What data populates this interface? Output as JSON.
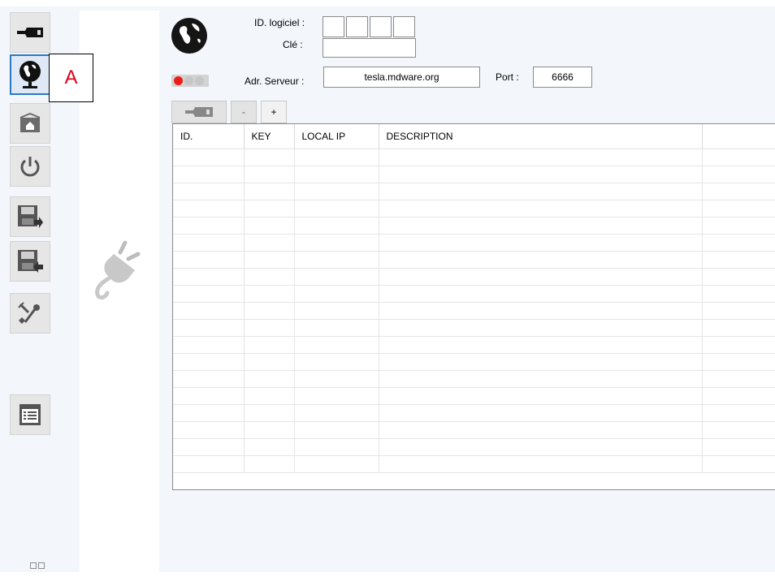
{
  "annotation": {
    "label": "A"
  },
  "toolbar": {
    "buttons": [
      {
        "name": "connect-button",
        "icon": "plug-usb-icon",
        "active": false
      },
      {
        "name": "remote-button",
        "icon": "globe-monitor-icon",
        "active": true
      },
      {
        "name": "home-button",
        "icon": "house-icon",
        "active": false
      },
      {
        "name": "power-button",
        "icon": "power-icon",
        "active": false
      },
      {
        "name": "save-export-button",
        "icon": "floppy-export-icon",
        "active": false
      },
      {
        "name": "save-import-button",
        "icon": "floppy-import-icon",
        "active": false
      },
      {
        "name": "tools-button",
        "icon": "tools-icon",
        "active": false
      },
      {
        "name": "list-button",
        "icon": "list-window-icon",
        "active": false
      }
    ]
  },
  "header": {
    "id_label": "ID. logiciel :",
    "key_label": "Clé :",
    "key_value": "",
    "server_label": "Adr. Serveur :",
    "server_value": "tesla.mdware.org",
    "port_label": "Port :",
    "port_value": "6666"
  },
  "controls": {
    "minus_label": "-",
    "plus_label": "+"
  },
  "table": {
    "columns": [
      "ID.",
      "KEY",
      "LOCAL IP",
      "DESCRIPTION",
      ""
    ],
    "row_count": 19
  },
  "colors": {
    "accent": "#2b78c2",
    "status_red": "#ee1b1b",
    "annotation_red": "#e0001a",
    "background": "#f3f6fb"
  }
}
